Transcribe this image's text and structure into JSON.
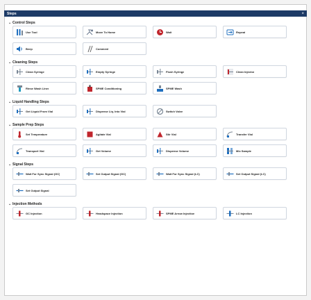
{
  "window": {
    "title": "Steps",
    "close_glyph": "×"
  },
  "sections": [
    {
      "title": "Control Steps",
      "rows": [
        [
          {
            "label": "Use Tool",
            "icon": "tool-icon",
            "color": "#1f6fbf"
          },
          {
            "label": "Move To Home",
            "icon": "home-icon",
            "color": "#6b7a8f"
          },
          {
            "label": "Wait",
            "icon": "clock-icon",
            "color": "#c0262d"
          },
          {
            "label": "Repeat",
            "icon": "repeat-icon",
            "color": "#1f6fbf"
          }
        ],
        [
          {
            "label": "Beep",
            "icon": "speaker-icon",
            "color": "#1f6fbf"
          },
          {
            "label": "Comment",
            "icon": "comment-icon",
            "color": "#666666"
          }
        ]
      ]
    },
    {
      "title": "Cleaning Steps",
      "rows": [
        [
          {
            "label": "Clean Syringe",
            "icon": "syringe-icon",
            "color": "#7a8795"
          },
          {
            "label": "Empty Syringe",
            "icon": "empty-syringe-icon",
            "color": "#1f6fbf"
          },
          {
            "label": "Flush Syringe",
            "icon": "flush-icon",
            "color": "#7a8795"
          },
          {
            "label": "Clean Injector",
            "icon": "injector-icon",
            "color": "#c0262d"
          }
        ],
        [
          {
            "label": "Rinse Wash Liner",
            "icon": "rinse-icon",
            "color": "#1f9bbf"
          },
          {
            "label": "SPME Conditioning",
            "icon": "conditioning-icon",
            "color": "#c0262d"
          },
          {
            "label": "SPME Wash",
            "icon": "wash-icon",
            "color": "#1f6fbf"
          }
        ]
      ]
    },
    {
      "title": "Liquid Handling Steps",
      "rows": [
        [
          {
            "label": "Get Liquid From Vial",
            "icon": "get-liquid-icon",
            "color": "#1f6fbf"
          },
          {
            "label": "Dispense Liq. Into Vial",
            "icon": "dispense-icon",
            "color": "#1f6fbf"
          },
          {
            "label": "Switch Valve",
            "icon": "valve-icon",
            "color": "#7a8795"
          }
        ]
      ]
    },
    {
      "title": "Sample Prep Steps",
      "rows": [
        [
          {
            "label": "Set Temperature",
            "icon": "thermometer-icon",
            "color": "#c0262d"
          },
          {
            "label": "Agitate Vial",
            "icon": "agitate-icon",
            "color": "#c0262d"
          },
          {
            "label": "Stir Vial",
            "icon": "stir-icon",
            "color": "#c0262d"
          },
          {
            "label": "Transfer Vial",
            "icon": "transfer-icon",
            "color": "#7a8795"
          }
        ],
        [
          {
            "label": "Transport Vial",
            "icon": "transport-icon",
            "color": "#7a8795"
          },
          {
            "label": "Get Volume",
            "icon": "volume-icon",
            "color": "#1f6fbf"
          },
          {
            "label": "Dispense Volume",
            "icon": "dispense-volume-icon",
            "color": "#1f6fbf"
          },
          {
            "label": "Mix Sample",
            "icon": "mix-icon",
            "color": "#1f6fbf"
          }
        ]
      ]
    },
    {
      "title": "Signal Steps",
      "rows": [
        [
          {
            "label": "Wait For Sync Signal (GC)",
            "icon": "signal-icon",
            "color": "#1f6fbf"
          },
          {
            "label": "Set Output Signal (GC)",
            "icon": "signal-icon",
            "color": "#1f6fbf"
          },
          {
            "label": "Wait For Sync Signal (LC)",
            "icon": "signal-icon",
            "color": "#1f6fbf"
          },
          {
            "label": "Set Output Signal (LC)",
            "icon": "signal-icon",
            "color": "#1f6fbf"
          }
        ],
        [
          {
            "label": "Set Output Signal",
            "icon": "signal-icon",
            "color": "#1f6fbf"
          }
        ]
      ]
    },
    {
      "title": "Injection Methods",
      "rows": [
        [
          {
            "label": "GC Injection",
            "icon": "gc-injection-icon",
            "color": "#c0262d"
          },
          {
            "label": "Headspace Injection",
            "icon": "headspace-injection-icon",
            "color": "#c0262d"
          },
          {
            "label": "SPME Arrow Injection",
            "icon": "spme-injection-icon",
            "color": "#c0262d"
          },
          {
            "label": "LC Injection",
            "icon": "lc-injection-icon",
            "color": "#1f6fbf"
          }
        ]
      ]
    }
  ]
}
